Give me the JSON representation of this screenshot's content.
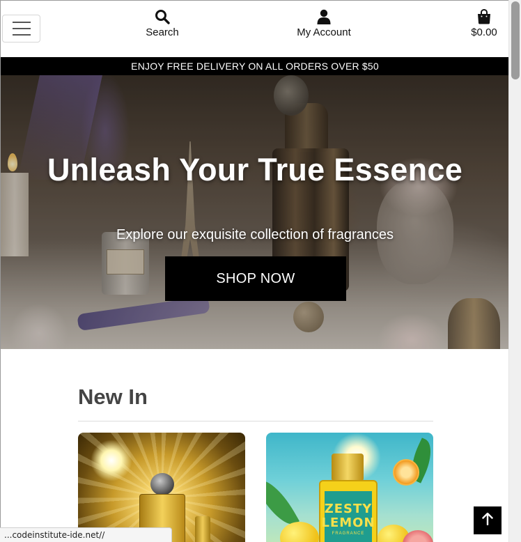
{
  "header": {
    "menu_label": "",
    "search_label": "Search",
    "account_label": "My Account",
    "bag_total": "$0.00"
  },
  "banner": {
    "text": "ENJOY FREE DELIVERY ON ALL ORDERS OVER $50"
  },
  "hero": {
    "title": "Unleash Your True Essence",
    "subtitle": "Explore our exquisite collection of fragrances",
    "cta_label": "SHOP NOW"
  },
  "new_in": {
    "heading": "New In",
    "products": [
      {
        "image_desc": "gold perfume bottle"
      },
      {
        "image_desc": "zesty lemon fragrance",
        "label_line1": "ZESTY",
        "label_line2": "LEMON",
        "label_line3": "FRAGRANCE"
      }
    ]
  },
  "status_bar": {
    "url": "...codeinstitute-ide.net//"
  },
  "colors": {
    "banner_bg": "#000000",
    "cta_bg": "#000000",
    "text": "#222222"
  },
  "icons": {
    "menu": "menu-icon",
    "search": "search-icon",
    "account": "user-icon",
    "bag": "shopping-bag-icon",
    "back_to_top": "arrow-up-icon"
  }
}
